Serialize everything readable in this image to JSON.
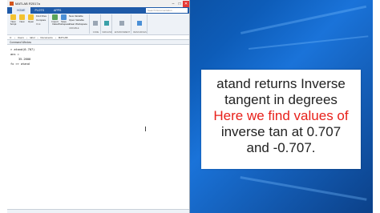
{
  "window": {
    "title": "MATLAB R2017a",
    "controls": [
      "–",
      "□",
      "✕"
    ]
  },
  "tabs": [
    {
      "label": "HOME",
      "active": true
    },
    {
      "label": "PLOTS",
      "active": false
    },
    {
      "label": "APPS",
      "active": false
    }
  ],
  "search_placeholder": "Search Documentation",
  "ribbon": {
    "new_script": "New Script",
    "new": "New",
    "open": "Open",
    "find_files": "Find Files",
    "compare": "Compare",
    "import_data": "Import Data",
    "save_workspace": "Save Workspace",
    "new_variable": "New Variable",
    "open_variable": "Open Variable",
    "clear_workspace": "Clear Workspace",
    "group_file": "FILE",
    "group_variable": "VARIABLE",
    "group_code": "CODE",
    "group_simulink": "SIMULINK",
    "group_environment": "ENVIRONMENT",
    "group_resources": "RESOURCES"
  },
  "address": {
    "parts": [
      "C:",
      "Users",
      "rahul",
      "Documents",
      "MATLAB"
    ]
  },
  "command_window": {
    "header": "Command Window",
    "lines": [
      "> atand(0.707)",
      "ans =",
      "35.2600",
      "fx >> atand"
    ]
  },
  "card": {
    "line1": "atand returns Inverse",
    "line2": "tangent in degrees",
    "line3": "Here we find values of",
    "line4": "inverse tan at 0.707",
    "line5": "and -0.707."
  },
  "colors": {
    "desktop": "#0d5cb8",
    "card_highlight": "#e8201a",
    "card_text": "#222222",
    "matlab_tab": "#1e5aa8"
  }
}
